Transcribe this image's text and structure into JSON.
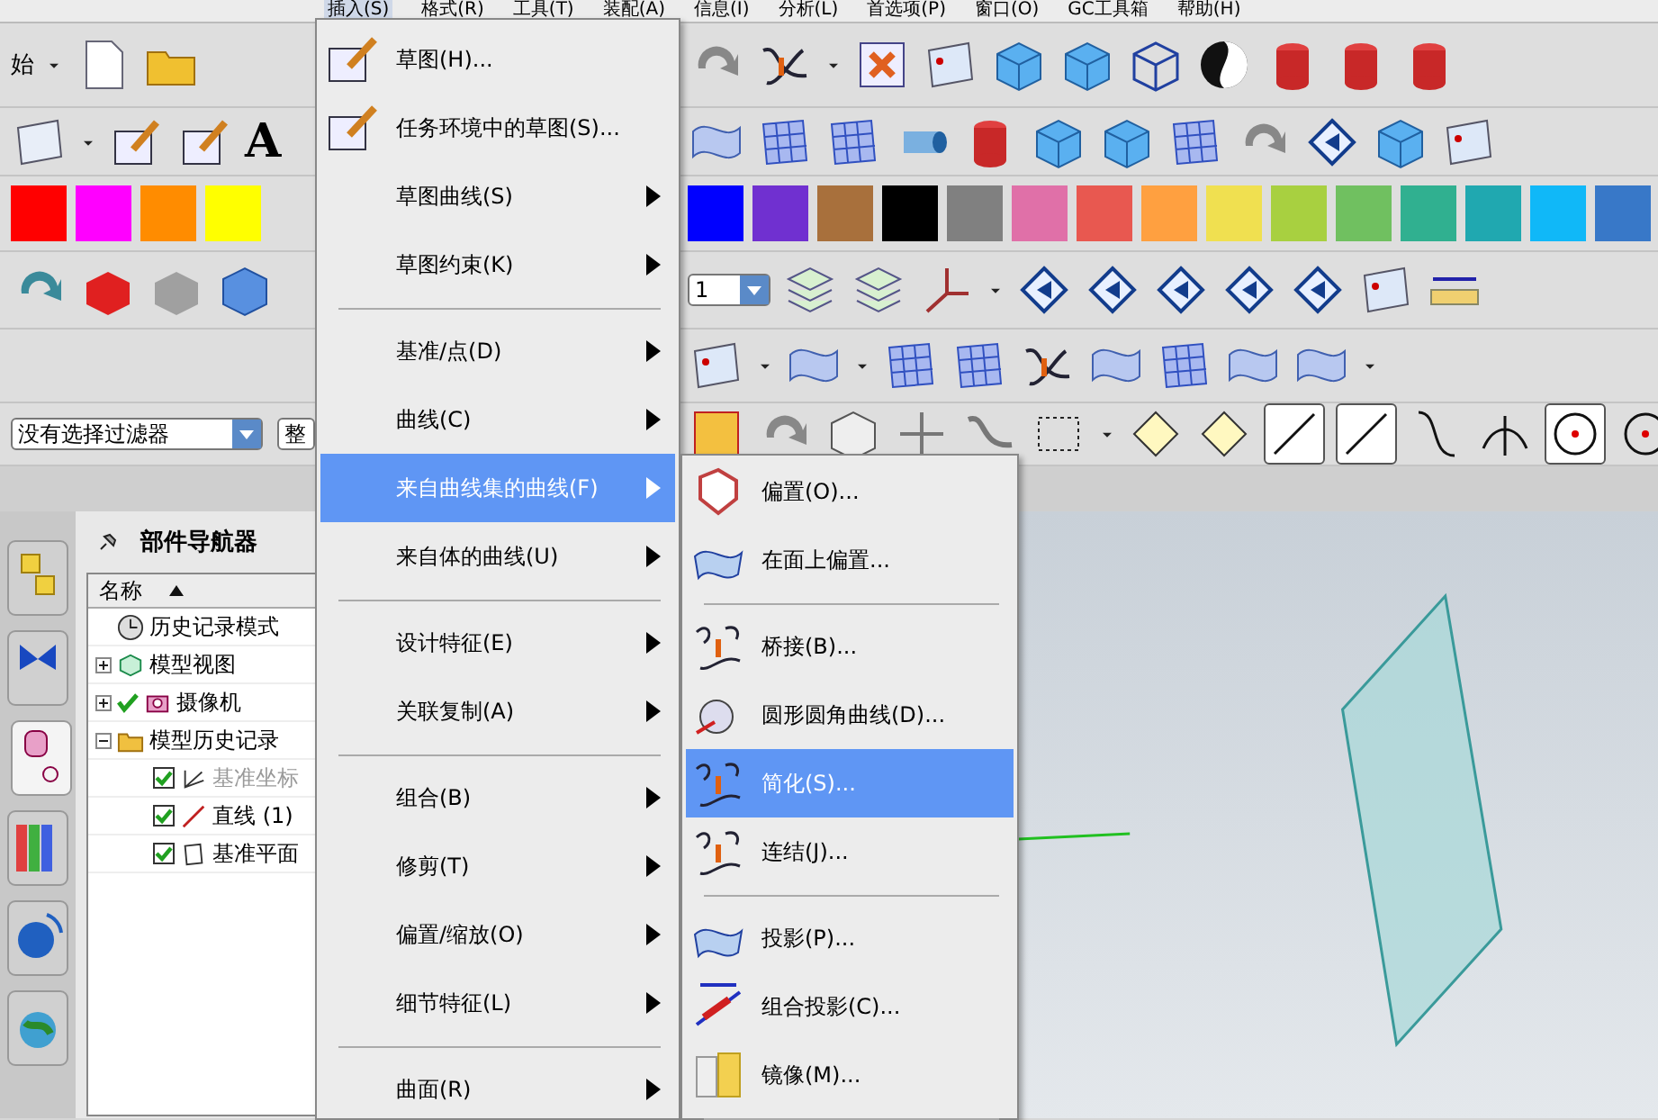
{
  "menu_bar": [
    "插入(S)",
    "格式(R)",
    "工具(T)",
    "装配(A)",
    "信息(I)",
    "分析(L)",
    "首选项(P)",
    "窗口(O)",
    "GC工具箱",
    "帮助(H)"
  ],
  "toolbar": {
    "start_label": "始",
    "text_tool": "A",
    "layer_value": "1"
  },
  "color_swatches_left": [
    {
      "color": "#ff0000"
    },
    {
      "color": "#ff00ff"
    },
    {
      "color": "#ff8c00"
    },
    {
      "color": "#ffff00"
    }
  ],
  "color_swatches_right": [
    {
      "color": "#0000ff"
    },
    {
      "color": "#7030d0"
    },
    {
      "color": "#a8703c"
    },
    {
      "color": "#000000"
    },
    {
      "color": "#808080"
    },
    {
      "color": "#e070a8"
    },
    {
      "color": "#e85850"
    },
    {
      "color": "#ffa040"
    },
    {
      "color": "#f0e050"
    },
    {
      "color": "#a8d040"
    },
    {
      "color": "#70c060"
    },
    {
      "color": "#30b090"
    },
    {
      "color": "#20a8b0"
    },
    {
      "color": "#10b8f8"
    },
    {
      "color": "#3878c8"
    }
  ],
  "filter": {
    "value": "没有选择过滤器",
    "scope": "整"
  },
  "side_tabs": [
    {
      "selected": false
    },
    {
      "selected": false
    },
    {
      "selected": true
    },
    {
      "selected": false
    },
    {
      "selected": false
    },
    {
      "selected": false
    }
  ],
  "navigator": {
    "title": "部件导航器",
    "column": "名称",
    "tree": [
      {
        "label": "历史记录模式"
      },
      {
        "label": "模型视图",
        "expanded": false
      },
      {
        "label": "摄像机",
        "expanded": false,
        "checked": true
      },
      {
        "label": "模型历史记录",
        "expanded": true,
        "children": [
          {
            "label": "基准坐标",
            "checked": true,
            "dimmed": true
          },
          {
            "label": "直线 (1)",
            "checked": true,
            "dimmed": false
          },
          {
            "label": "基准平面",
            "checked": true,
            "dimmed": false
          }
        ]
      }
    ]
  },
  "insert_menu": [
    {
      "kind": "item",
      "label": "草图(H)...",
      "submenu": false,
      "selected": false
    },
    {
      "kind": "item",
      "label": "任务环境中的草图(S)...",
      "submenu": false,
      "selected": false
    },
    {
      "kind": "item",
      "label": "草图曲线(S)",
      "submenu": true,
      "selected": false
    },
    {
      "kind": "item",
      "label": "草图约束(K)",
      "submenu": true,
      "selected": false
    },
    {
      "kind": "separator"
    },
    {
      "kind": "item",
      "label": "基准/点(D)",
      "submenu": true,
      "selected": false
    },
    {
      "kind": "item",
      "label": "曲线(C)",
      "submenu": true,
      "selected": false
    },
    {
      "kind": "item",
      "label": "来自曲线集的曲线(F)",
      "submenu": true,
      "selected": true
    },
    {
      "kind": "item",
      "label": "来自体的曲线(U)",
      "submenu": true,
      "selected": false
    },
    {
      "kind": "separator"
    },
    {
      "kind": "item",
      "label": "设计特征(E)",
      "submenu": true,
      "selected": false
    },
    {
      "kind": "item",
      "label": "关联复制(A)",
      "submenu": true,
      "selected": false
    },
    {
      "kind": "separator"
    },
    {
      "kind": "item",
      "label": "组合(B)",
      "submenu": true,
      "selected": false
    },
    {
      "kind": "item",
      "label": "修剪(T)",
      "submenu": true,
      "selected": false
    },
    {
      "kind": "item",
      "label": "偏置/缩放(O)",
      "submenu": true,
      "selected": false
    },
    {
      "kind": "item",
      "label": "细节特征(L)",
      "submenu": true,
      "selected": false
    },
    {
      "kind": "separator"
    },
    {
      "kind": "item",
      "label": "曲面(R)",
      "submenu": true,
      "selected": false
    }
  ],
  "curve_submenu": [
    {
      "kind": "item",
      "label": "偏置(O)...",
      "selected": false
    },
    {
      "kind": "item",
      "label": "在面上偏置...",
      "selected": false
    },
    {
      "kind": "separator"
    },
    {
      "kind": "item",
      "label": "桥接(B)...",
      "selected": false
    },
    {
      "kind": "item",
      "label": "圆形圆角曲线(D)...",
      "selected": false
    },
    {
      "kind": "item",
      "label": "简化(S)...",
      "selected": true
    },
    {
      "kind": "item",
      "label": "连结(J)...",
      "selected": false
    },
    {
      "kind": "separator"
    },
    {
      "kind": "item",
      "label": "投影(P)...",
      "selected": false
    },
    {
      "kind": "item",
      "label": "组合投影(C)...",
      "selected": false
    },
    {
      "kind": "item",
      "label": "镜像(M)...",
      "selected": false
    },
    {
      "kind": "separator"
    }
  ]
}
